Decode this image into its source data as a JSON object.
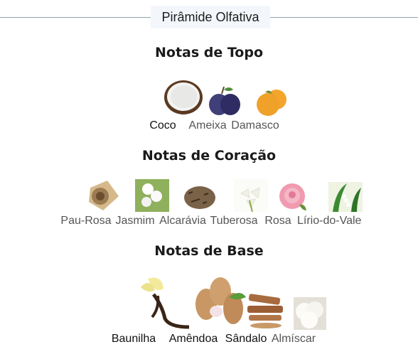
{
  "header": {
    "title": "Pirâmide Olfativa"
  },
  "sections": [
    {
      "title": "Notas de Topo",
      "notes": [
        {
          "label": "Coco",
          "icon": "coconut-icon"
        },
        {
          "label": "Ameixa",
          "icon": "plum-icon"
        },
        {
          "label": "Damasco",
          "icon": "apricot-icon"
        }
      ]
    },
    {
      "title": "Notas de Coração",
      "notes": [
        {
          "label": "Pau-Rosa",
          "icon": "rosewood-icon"
        },
        {
          "label": "Jasmim",
          "icon": "jasmine-icon"
        },
        {
          "label": "Alcarávia",
          "icon": "caraway-icon"
        },
        {
          "label": "Tuberosa",
          "icon": "tuberose-icon"
        },
        {
          "label": "Rosa",
          "icon": "rose-icon"
        },
        {
          "label": "Lírio-do-Vale",
          "icon": "lily-of-the-valley-icon"
        }
      ]
    },
    {
      "title": "Notas de Base",
      "notes": [
        {
          "label": "Baunilha",
          "icon": "vanilla-icon"
        },
        {
          "label": "Amêndoa",
          "icon": "almond-icon"
        },
        {
          "label": "Sândalo",
          "icon": "sandalwood-icon"
        },
        {
          "label": "Almíscar",
          "icon": "musk-icon"
        }
      ]
    }
  ]
}
